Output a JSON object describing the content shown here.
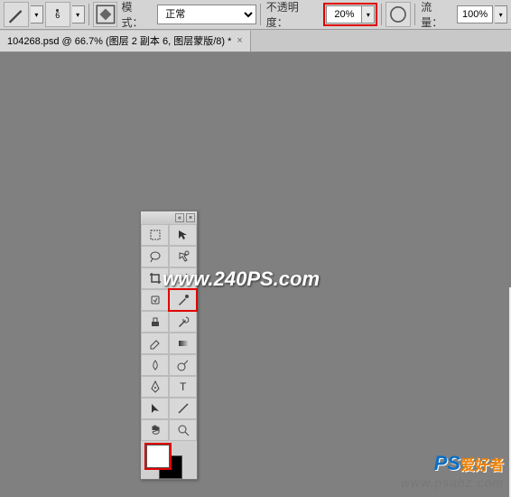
{
  "toolbar": {
    "brush_size": "6",
    "mode_label": "模式：",
    "mode_value": "正常",
    "opacity_label": "不透明度：",
    "opacity_value": "20%",
    "flow_label": "流量：",
    "flow_value": "100%"
  },
  "tab": {
    "title": "104268.psd @ 66.7% (图层 2 副本 6, 图层蒙版/8) *",
    "close": "×"
  },
  "watermark": {
    "main": "www.240PS.com",
    "logo_ps": "PS",
    "logo_cn": "爱好者",
    "url": "www.psahz.com"
  },
  "colors": {
    "foreground": "#ffffff",
    "background": "#000000",
    "highlight": "#e00000"
  }
}
